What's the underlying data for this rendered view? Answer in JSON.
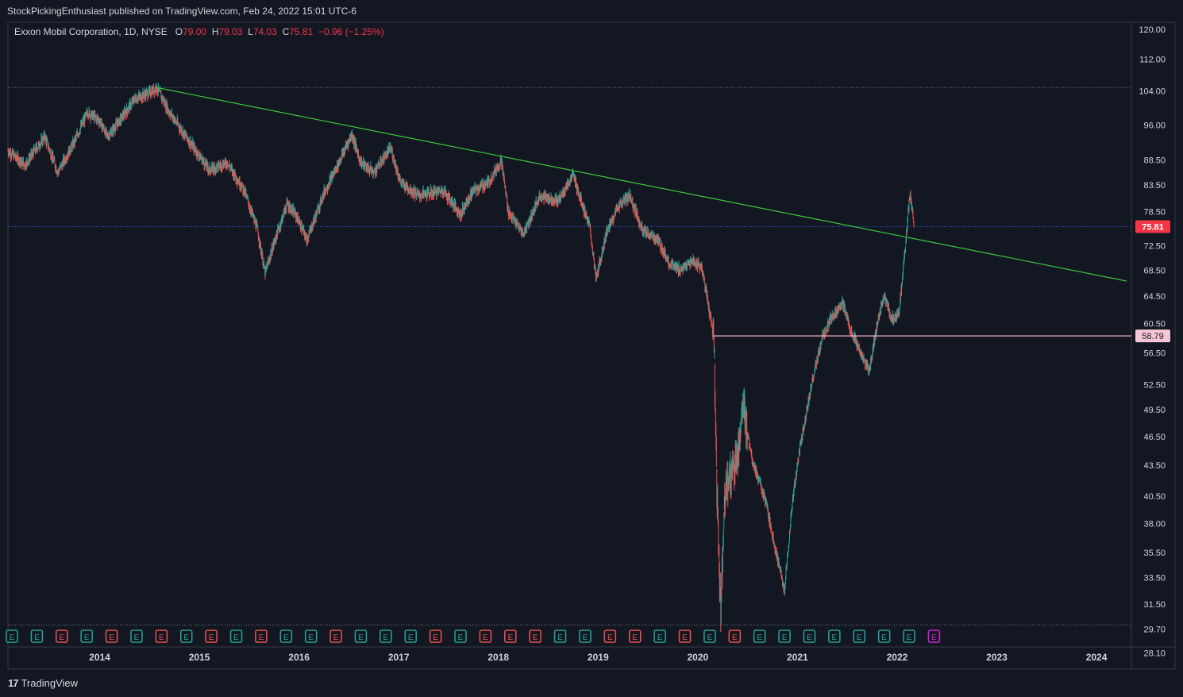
{
  "header": {
    "text": "StockPickingEnthusiast published on TradingView.com, Feb 24, 2022 15:01 UTC-6"
  },
  "legend": {
    "symbol": "Exxon Mobil Corporation, 1D, NYSE",
    "open_label": "O",
    "open": "79.00",
    "high_label": "H",
    "high": "79.03",
    "low_label": "L",
    "low": "74.03",
    "close_label": "C",
    "close": "75.81",
    "change": "−0.96 (−1.25%)"
  },
  "footer": {
    "logo": "17",
    "brand": "TradingView"
  },
  "colors": {
    "background": "#131722",
    "up": "#26a69a",
    "down": "#ef5350",
    "trendline": "#3cc83c",
    "support_line": "#f7b5c8",
    "price_label_bg": "#f23645",
    "support_label_bg": "#f7c6d4",
    "earnings_future": "#d620d6"
  },
  "chart_data": {
    "type": "candlestick",
    "symbol": "XOM",
    "interval": "1D",
    "y_scale": "log",
    "ylim": [
      28.5,
      122
    ],
    "x_range": [
      2013.08,
      2024.35
    ],
    "y_ticks": [
      "120.00",
      "112.00",
      "104.00",
      "96.00",
      "88.50",
      "83.50",
      "78.50",
      "72.50",
      "68.50",
      "64.50",
      "60.50",
      "56.50",
      "52.50",
      "49.50",
      "46.50",
      "43.50",
      "40.50",
      "38.00",
      "35.50",
      "33.50",
      "31.50",
      "29.70",
      "28.10"
    ],
    "x_ticks": [
      "2014",
      "2015",
      "2016",
      "2017",
      "2018",
      "2019",
      "2020",
      "2021",
      "2022",
      "2023",
      "2024"
    ],
    "last_price": "75.81",
    "support_level": "58.79",
    "dotted_levels": [
      104.8,
      30.0
    ],
    "trendline": {
      "from": [
        2014.57,
        104.8
      ],
      "to": [
        2024.3,
        66.8
      ]
    },
    "support_line_start": 2020.16,
    "price_path": [
      [
        2013.08,
        90.5
      ],
      [
        2013.25,
        87.5
      ],
      [
        2013.45,
        93.5
      ],
      [
        2013.58,
        86
      ],
      [
        2013.75,
        92.5
      ],
      [
        2013.88,
        99
      ],
      [
        2014.0,
        97
      ],
      [
        2014.08,
        93.5
      ],
      [
        2014.2,
        97
      ],
      [
        2014.35,
        102
      ],
      [
        2014.5,
        103.5
      ],
      [
        2014.57,
        104.8
      ],
      [
        2014.7,
        99
      ],
      [
        2014.85,
        94
      ],
      [
        2014.98,
        90
      ],
      [
        2015.1,
        86.5
      ],
      [
        2015.28,
        88
      ],
      [
        2015.45,
        82.5
      ],
      [
        2015.58,
        75.5
      ],
      [
        2015.66,
        68
      ],
      [
        2015.75,
        73
      ],
      [
        2015.88,
        80
      ],
      [
        2015.98,
        77.5
      ],
      [
        2016.08,
        73.5
      ],
      [
        2016.25,
        82
      ],
      [
        2016.4,
        88
      ],
      [
        2016.53,
        94
      ],
      [
        2016.62,
        88
      ],
      [
        2016.75,
        86
      ],
      [
        2016.92,
        91
      ],
      [
        2017.02,
        84
      ],
      [
        2017.2,
        81.5
      ],
      [
        2017.45,
        82.5
      ],
      [
        2017.62,
        78
      ],
      [
        2017.75,
        82.5
      ],
      [
        2017.9,
        84
      ],
      [
        2018.03,
        88.5
      ],
      [
        2018.1,
        78.5
      ],
      [
        2018.25,
        74.5
      ],
      [
        2018.42,
        81.5
      ],
      [
        2018.6,
        80.5
      ],
      [
        2018.75,
        85.5
      ],
      [
        2018.92,
        75.5
      ],
      [
        2018.98,
        67
      ],
      [
        2019.08,
        74.5
      ],
      [
        2019.2,
        79.5
      ],
      [
        2019.32,
        81.5
      ],
      [
        2019.45,
        75
      ],
      [
        2019.6,
        73.5
      ],
      [
        2019.72,
        69.5
      ],
      [
        2019.82,
        68.5
      ],
      [
        2019.95,
        70
      ],
      [
        2020.04,
        69
      ],
      [
        2020.12,
        62
      ],
      [
        2020.16,
        58.8
      ],
      [
        2020.19,
        42
      ],
      [
        2020.23,
        31
      ],
      [
        2020.27,
        41
      ],
      [
        2020.4,
        44.5
      ],
      [
        2020.45,
        50
      ],
      [
        2020.55,
        44
      ],
      [
        2020.68,
        40
      ],
      [
        2020.8,
        35
      ],
      [
        2020.87,
        32.5
      ],
      [
        2020.95,
        40
      ],
      [
        2021.02,
        45
      ],
      [
        2021.15,
        53
      ],
      [
        2021.25,
        58.5
      ],
      [
        2021.35,
        61.5
      ],
      [
        2021.45,
        63.5
      ],
      [
        2021.55,
        59
      ],
      [
        2021.65,
        56
      ],
      [
        2021.72,
        54
      ],
      [
        2021.8,
        60.5
      ],
      [
        2021.87,
        64.5
      ],
      [
        2021.95,
        61
      ],
      [
        2022.02,
        62
      ],
      [
        2022.08,
        72
      ],
      [
        2022.11,
        78
      ],
      [
        2022.13,
        82
      ],
      [
        2022.15,
        79
      ],
      [
        2022.17,
        75.81
      ]
    ],
    "earnings_markers": [
      {
        "x": 2013.12,
        "result": "up"
      },
      {
        "x": 2013.37,
        "result": "up"
      },
      {
        "x": 2013.62,
        "result": "down"
      },
      {
        "x": 2013.87,
        "result": "up"
      },
      {
        "x": 2014.12,
        "result": "down"
      },
      {
        "x": 2014.37,
        "result": "up"
      },
      {
        "x": 2014.62,
        "result": "down"
      },
      {
        "x": 2014.87,
        "result": "up"
      },
      {
        "x": 2015.12,
        "result": "down"
      },
      {
        "x": 2015.37,
        "result": "up"
      },
      {
        "x": 2015.62,
        "result": "down"
      },
      {
        "x": 2015.87,
        "result": "up"
      },
      {
        "x": 2016.12,
        "result": "up"
      },
      {
        "x": 2016.37,
        "result": "down"
      },
      {
        "x": 2016.62,
        "result": "up"
      },
      {
        "x": 2016.87,
        "result": "up"
      },
      {
        "x": 2017.12,
        "result": "up"
      },
      {
        "x": 2017.37,
        "result": "down"
      },
      {
        "x": 2017.62,
        "result": "up"
      },
      {
        "x": 2017.87,
        "result": "down"
      },
      {
        "x": 2018.12,
        "result": "down"
      },
      {
        "x": 2018.37,
        "result": "down"
      },
      {
        "x": 2018.62,
        "result": "up"
      },
      {
        "x": 2018.87,
        "result": "up"
      },
      {
        "x": 2019.12,
        "result": "down"
      },
      {
        "x": 2019.37,
        "result": "down"
      },
      {
        "x": 2019.62,
        "result": "up"
      },
      {
        "x": 2019.87,
        "result": "down"
      },
      {
        "x": 2020.12,
        "result": "up"
      },
      {
        "x": 2020.37,
        "result": "down"
      },
      {
        "x": 2020.62,
        "result": "up"
      },
      {
        "x": 2020.87,
        "result": "up"
      },
      {
        "x": 2021.12,
        "result": "up"
      },
      {
        "x": 2021.37,
        "result": "up"
      },
      {
        "x": 2021.62,
        "result": "up"
      },
      {
        "x": 2021.87,
        "result": "up"
      },
      {
        "x": 2022.12,
        "result": "up"
      },
      {
        "x": 2022.37,
        "result": "future"
      }
    ],
    "earnings_label": "E"
  }
}
